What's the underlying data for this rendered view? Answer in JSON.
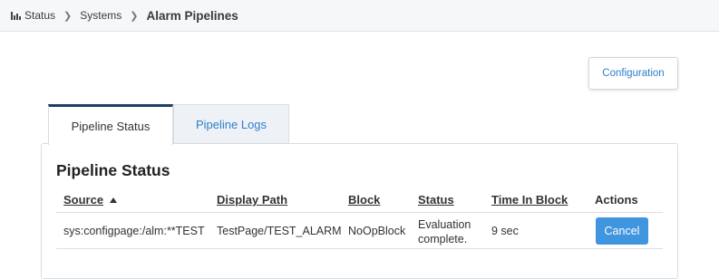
{
  "breadcrumb": {
    "items": [
      "Status",
      "Systems",
      "Alarm Pipelines"
    ]
  },
  "toolbar": {
    "configuration_label": "Configuration"
  },
  "tabs": [
    {
      "label": "Pipeline Status",
      "active": true
    },
    {
      "label": "Pipeline Logs",
      "active": false
    }
  ],
  "panel": {
    "title": "Pipeline Status"
  },
  "table": {
    "columns": [
      "Source",
      "Display Path",
      "Block",
      "Status",
      "Time In Block",
      "Actions"
    ],
    "sorted_column": "Source",
    "sort_direction": "ascending",
    "rows": [
      {
        "source": "sys:configpage:/alm:**TEST",
        "display_path": "TestPage/TEST_ALARM",
        "block": "NoOpBlock",
        "status": "Evaluation complete.",
        "time_in_block": "9 sec",
        "action_label": "Cancel"
      }
    ]
  },
  "colors": {
    "accent": "#2f7ec9",
    "active_tab_border": "#1d3f66",
    "cancel_button": "#3f95de"
  }
}
